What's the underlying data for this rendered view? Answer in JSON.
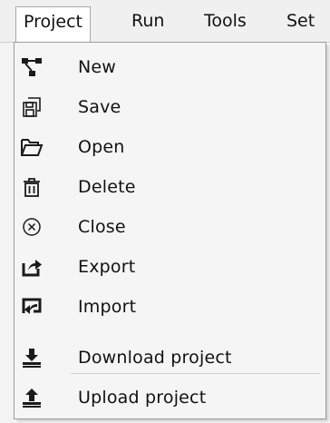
{
  "menubar": {
    "items": [
      {
        "label": "Project"
      },
      {
        "label": "Run"
      },
      {
        "label": "Tools"
      },
      {
        "label": "Set"
      }
    ]
  },
  "menu": {
    "items": [
      {
        "label": "New",
        "icon": "network-icon"
      },
      {
        "label": "Save",
        "icon": "save-copy-icon"
      },
      {
        "label": "Open",
        "icon": "folder-open-icon"
      },
      {
        "label": "Delete",
        "icon": "trash-icon"
      },
      {
        "label": "Close",
        "icon": "close-circle-icon"
      },
      {
        "label": "Export",
        "icon": "export-icon"
      },
      {
        "label": "Import",
        "icon": "import-icon"
      },
      {
        "label": "Download project",
        "icon": "download-icon"
      },
      {
        "label": "Upload project",
        "icon": "upload-icon"
      }
    ]
  },
  "colors": {
    "menu_bg": "#f5f5f5",
    "menubar_bg": "#f0f0f0",
    "text": "#111111",
    "icon": "#1a1a1a"
  }
}
